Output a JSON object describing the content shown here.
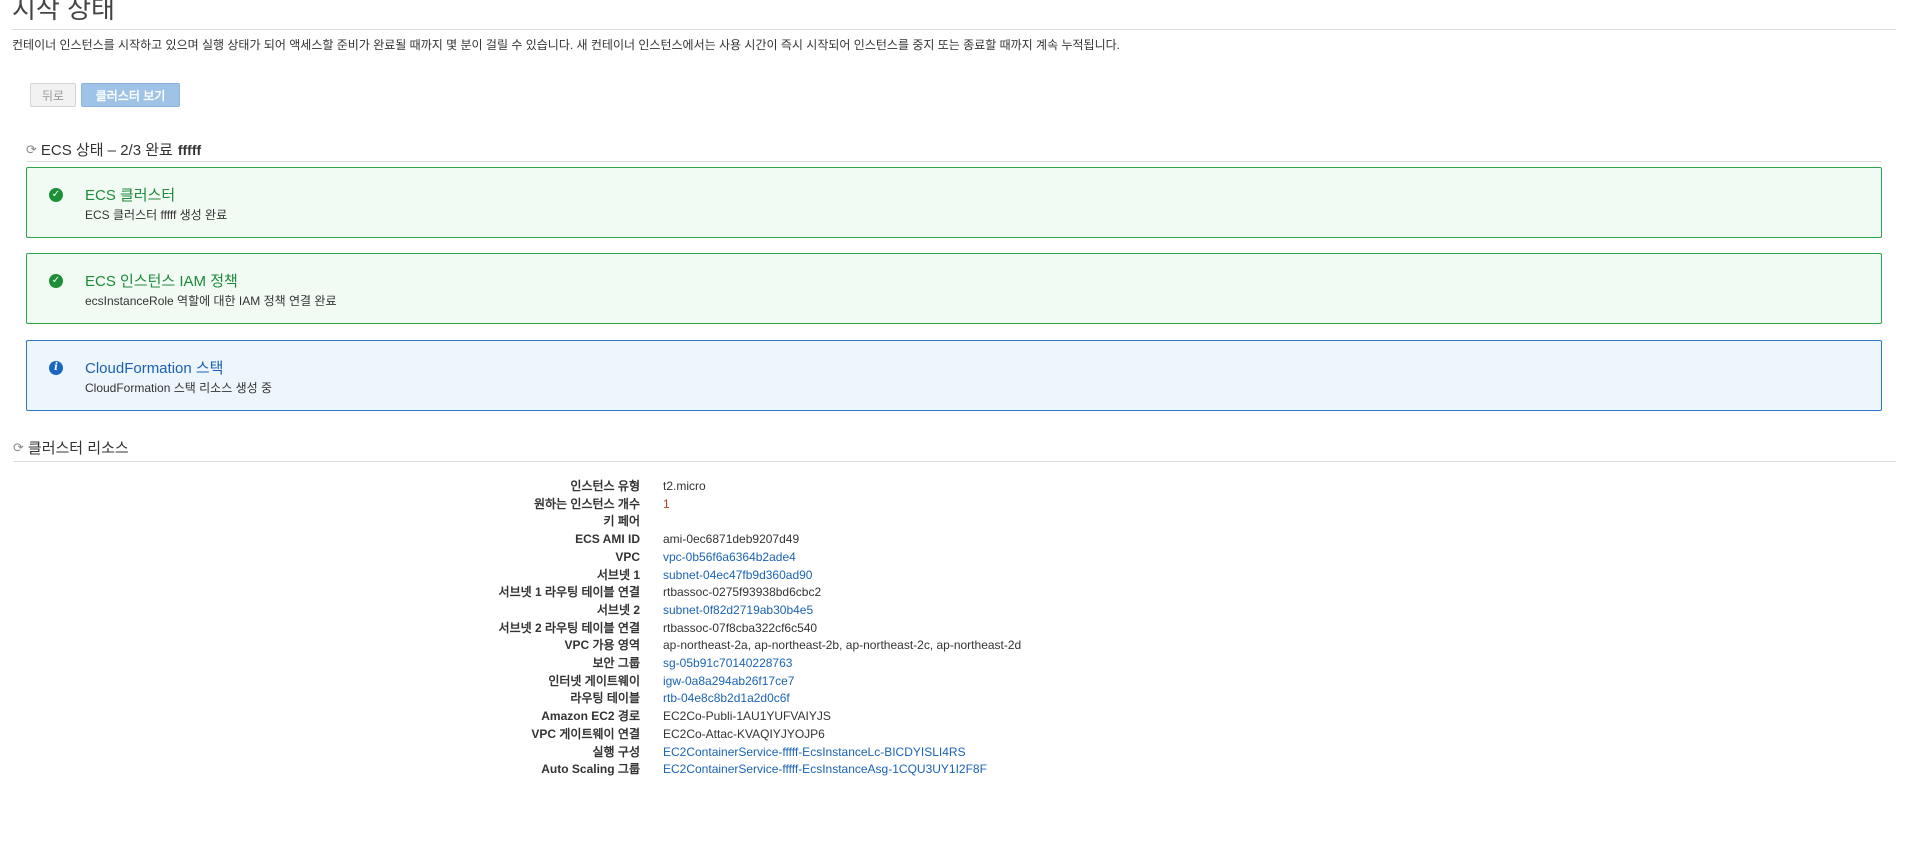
{
  "page": {
    "title": "시작 상태",
    "description": "컨테이너 인스턴스를 시작하고 있으며 실행 상태가 되어 액세스할 준비가 완료될 때까지 몇 분이 걸릴 수 있습니다. 새 컨테이너 인스턴스에서는 사용 시간이 즉시 시작되어 인스턴스를 중지 또는 종료할 때까지 계속 누적됩니다."
  },
  "buttons": {
    "back": "뒤로",
    "view_cluster": "클러스터 보기"
  },
  "ecs_status": {
    "label": "ECS 상태 – 2/3 완료",
    "cluster_name": "fffff",
    "spinner_icon": "refresh-icon",
    "items": [
      {
        "state": "success",
        "icon": "check-circle-icon",
        "title": "ECS 클러스터",
        "subtitle": "ECS 클러스터 fffff 생성 완료"
      },
      {
        "state": "success",
        "icon": "check-circle-icon",
        "title": "ECS 인스턴스 IAM 정책",
        "subtitle": "ecsInstanceRole 역할에 대한 IAM 정책 연결 완료"
      },
      {
        "state": "info",
        "icon": "info-circle-icon",
        "title": "CloudFormation 스택",
        "subtitle": "CloudFormation 스택 리소스 생성 중"
      }
    ]
  },
  "cluster_resources": {
    "label": "클러스터 리소스",
    "spinner_icon": "refresh-icon",
    "rows": [
      {
        "label": "인스턴스 유형",
        "value": "t2.micro",
        "style": "plain"
      },
      {
        "label": "원하는 인스턴스 개수",
        "value": "1",
        "style": "red"
      },
      {
        "label": "키 페어",
        "value": "",
        "style": "plain"
      },
      {
        "label": "ECS AMI ID",
        "value": "ami-0ec6871deb9207d49",
        "style": "plain"
      },
      {
        "label": "VPC",
        "value": "vpc-0b56f6a6364b2ade4",
        "style": "link"
      },
      {
        "label": "서브넷 1",
        "value": "subnet-04ec47fb9d360ad90",
        "style": "link"
      },
      {
        "label": "서브넷 1 라우팅 테이블 연결",
        "value": "rtbassoc-0275f93938bd6cbc2",
        "style": "plain"
      },
      {
        "label": "서브넷 2",
        "value": "subnet-0f82d2719ab30b4e5",
        "style": "link"
      },
      {
        "label": "서브넷 2 라우팅 테이블 연결",
        "value": "rtbassoc-07f8cba322cf6c540",
        "style": "plain"
      },
      {
        "label": "VPC 가용 영역",
        "value": "ap-northeast-2a, ap-northeast-2b, ap-northeast-2c, ap-northeast-2d",
        "style": "plain"
      },
      {
        "label": "보안 그룹",
        "value": "sg-05b91c70140228763",
        "style": "link"
      },
      {
        "label": "인터넷 게이트웨이",
        "value": "igw-0a8a294ab26f17ce7",
        "style": "link"
      },
      {
        "label": "라우팅 테이블",
        "value": "rtb-04e8c8b2d1a2d0c6f",
        "style": "link"
      },
      {
        "label": "Amazon EC2 경로",
        "value": "EC2Co-Publi-1AU1YUFVAIYJS",
        "style": "plain"
      },
      {
        "label": "VPC 게이트웨이 연결",
        "value": "EC2Co-Attac-KVAQIYJYOJP6",
        "style": "plain"
      },
      {
        "label": "실행 구성",
        "value": "EC2ContainerService-fffff-EcsInstanceLc-BICDYISLI4RS",
        "style": "link"
      },
      {
        "label": "Auto Scaling 그룹",
        "value": "EC2ContainerService-fffff-EcsInstanceAsg-1CQU3UY1I2F8F",
        "style": "link"
      }
    ]
  }
}
